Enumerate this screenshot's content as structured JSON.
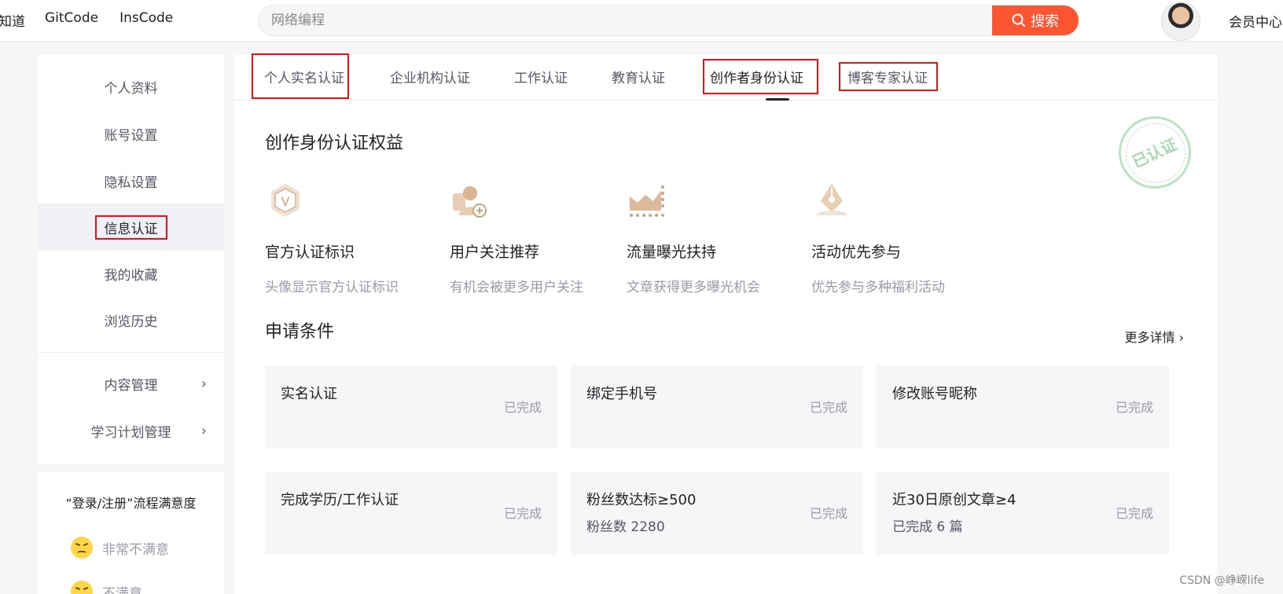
{
  "topbar": {
    "nav": [
      "知道",
      "GitCode",
      "InsCode"
    ],
    "search_placeholder": "网络编程",
    "search_button": "搜索",
    "member_center": "会员中心"
  },
  "sidebar": {
    "items": [
      {
        "label": "个人资料"
      },
      {
        "label": "账号设置"
      },
      {
        "label": "隐私设置"
      },
      {
        "label": "信息认证",
        "active": true
      },
      {
        "label": "我的收藏"
      },
      {
        "label": "浏览历史"
      },
      {
        "label": "内容管理"
      },
      {
        "label": "学习计划管理"
      }
    ]
  },
  "survey": {
    "title": "“登录/注册”流程满意度",
    "options": [
      "非常不满意",
      "不满意"
    ]
  },
  "tabs": [
    {
      "label": "个人实名认证"
    },
    {
      "label": "企业机构认证"
    },
    {
      "label": "工作认证"
    },
    {
      "label": "教育认证"
    },
    {
      "label": "创作者身份认证",
      "active": true
    },
    {
      "label": "博客专家认证"
    }
  ],
  "benefits_title": "创作身份认证权益",
  "benefits": [
    {
      "icon": "v-badge-icon",
      "title": "官方认证标识",
      "desc": "头像显示官方认证标识"
    },
    {
      "icon": "user-add-icon",
      "title": "用户关注推荐",
      "desc": "有机会被更多用户关注"
    },
    {
      "icon": "traffic-chart-icon",
      "title": "流量曝光扶持",
      "desc": "文章获得更多曝光机会"
    },
    {
      "icon": "pen-nib-icon",
      "title": "活动优先参与",
      "desc": "优先参与多种福利活动"
    }
  ],
  "stamp_text": "已认证",
  "conditions_title": "申请条件",
  "more_details": "更多详情",
  "conditions": [
    {
      "name": "实名认证",
      "status": "已完成",
      "sub": ""
    },
    {
      "name": "绑定手机号",
      "status": "已完成",
      "sub": ""
    },
    {
      "name": "修改账号昵称",
      "status": "已完成",
      "sub": ""
    },
    {
      "name": "完成学历/工作认证",
      "status": "已完成",
      "sub": ""
    },
    {
      "name": "粉丝数达标≥500",
      "status": "已完成",
      "sub": "粉丝数 2280"
    },
    {
      "name": "近30日原创文章≥4",
      "status": "已完成",
      "sub": "已完成 6 篇"
    }
  ],
  "colors": {
    "accent": "#fc5531",
    "highlight_box": "#e01515",
    "stamp": "#b9e3c2"
  },
  "watermark": "CSDN @峥嵘life"
}
